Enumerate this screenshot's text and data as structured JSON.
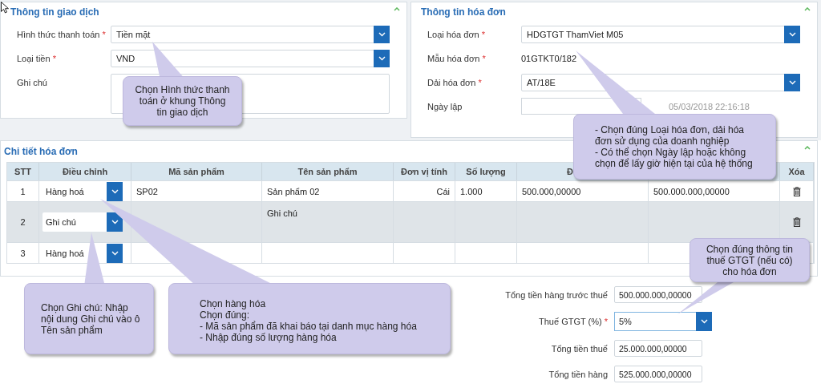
{
  "transaction_panel": {
    "title": "Thông tin giao dịch",
    "fields": [
      {
        "label": "Hình thức thanh toán",
        "required_mark": "*",
        "kind": "dropdown",
        "value": "Tiền mặt"
      },
      {
        "label": "Loại tiền",
        "required_mark": "*",
        "kind": "dropdown",
        "value": "VND"
      },
      {
        "label": "Ghi chú",
        "kind": "textarea"
      }
    ]
  },
  "invoice_panel": {
    "title": "Thông tin hóa đơn",
    "fields": [
      {
        "label": "Loại hóa đơn",
        "required_mark": "*",
        "kind": "dropdown",
        "value": "HDGTGT ThamViet M05"
      },
      {
        "label": "Mẫu hóa đơn",
        "required_mark": "*",
        "kind": "text",
        "value": "01GTKT0/182"
      },
      {
        "label": "Dải hóa đơn",
        "required_mark": "*",
        "kind": "dropdown",
        "value": "AT/18E"
      },
      {
        "label": "Ngày lập",
        "kind": "date",
        "hint": "05/03/2018 22:16:18"
      }
    ]
  },
  "detail_panel": {
    "title": "Chi tiết hóa đơn",
    "columns": [
      {
        "kind": "center",
        "label": "STT"
      },
      {
        "kind": "center",
        "label": "Điều chỉnh"
      },
      {
        "kind": "center",
        "label": "Mã sản phẩm"
      },
      {
        "kind": "center",
        "label": "Tên sản phẩm"
      },
      {
        "kind": "center",
        "label": "Đơn vị tính"
      },
      {
        "kind": "center",
        "label": "Số lượng"
      },
      {
        "kind": "partial",
        "label": "Đ"
      },
      {
        "kind": "covered"
      },
      {
        "kind": "center",
        "label": "Xóa"
      }
    ],
    "rows": [
      {
        "kind": "goods",
        "stt": "1",
        "adjust": "Hàng hoá",
        "code": "SP02",
        "name": "Sản phẩm 02",
        "unit": "Cái",
        "quantity": "1.000",
        "unit_price": "500.000,00000",
        "amount": "500.000.000,00000",
        "deletable": true
      },
      {
        "kind": "note",
        "stt": "2",
        "adjust": "Ghi chú",
        "name": "Ghi chú",
        "deletable": true
      },
      {
        "kind": "goods",
        "stt": "3",
        "adjust": "Hàng hoá"
      }
    ]
  },
  "totals": [
    {
      "label": "Tổng tiền hàng trước thuế",
      "kind": "text",
      "value": "500.000.000,00000"
    },
    {
      "label": "Thuế GTGT (%)",
      "required_mark": "*",
      "kind": "dropdown",
      "value": "5%"
    },
    {
      "label": "Tổng tiền thuế",
      "kind": "text",
      "value": "25.000.000,00000"
    },
    {
      "label": "Tổng tiền hàng",
      "kind": "text",
      "value": "525.000.000,00000"
    }
  ],
  "callouts": [
    {
      "text": "Chọn Hình thức thanh\ntoán ở khung Thông\ntin giao dịch"
    },
    {
      "text": "- Chọn đúng Loại hóa đơn, dải hóa\nđơn sử dụng của doanh nghiệp\n- Có thể chọn Ngày lập hoặc không\nchọn để lấy giờ hiện tại của hệ thống"
    },
    {
      "text": "Chọn đúng thông tin\nthuế GTGT (nếu có)\ncho hóa đơn"
    },
    {
      "text": "Chọn Ghi chú: Nhập\nnội dung Ghi chú vào ô\nTên sản phẩm"
    },
    {
      "text": "Chọn hàng hóa\nChọn đúng:\n- Mã sản phẩm đã khai báo tại danh mục hàng hóa\n- Nhập đúng số lượng hàng hóa"
    }
  ]
}
